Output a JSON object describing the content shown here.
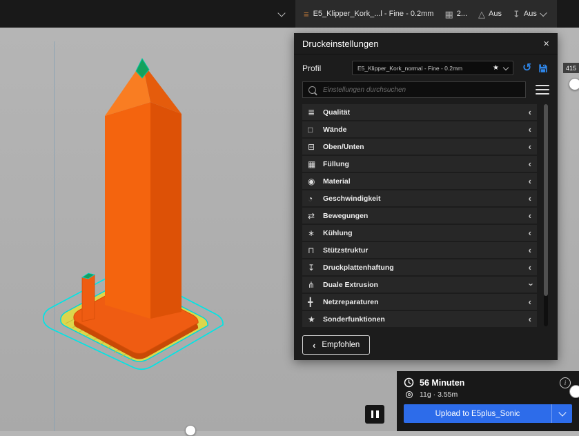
{
  "topbar": {
    "profile_summary": "E5_Klipper_Kork_...l - Fine - 0.2mm",
    "infill_value": "2...",
    "support_value": "Aus",
    "adhesion_value": "Aus"
  },
  "panel": {
    "title": "Druckeinstellungen",
    "profile_label": "Profil",
    "profile_value": "E5_Klipper_Kork_normal - Fine - 0.2mm",
    "search_placeholder": "Einstellungen durchsuchen",
    "recommended_label": "Empfohlen",
    "categories": [
      {
        "icon": "quality",
        "glyph": "≣",
        "label": "Qualität"
      },
      {
        "icon": "walls",
        "glyph": "□",
        "label": "Wände"
      },
      {
        "icon": "top-bottom",
        "glyph": "⊟",
        "label": "Oben/Unten"
      },
      {
        "icon": "infill",
        "glyph": "▦",
        "label": "Füllung"
      },
      {
        "icon": "material",
        "glyph": "◉",
        "label": "Material"
      },
      {
        "icon": "speed",
        "glyph": "◔",
        "label": "Geschwindigkeit"
      },
      {
        "icon": "travel",
        "glyph": "⇄",
        "label": "Bewegungen"
      },
      {
        "icon": "cooling",
        "glyph": "∗",
        "label": "Kühlung"
      },
      {
        "icon": "support",
        "glyph": "⊓",
        "label": "Stützstruktur"
      },
      {
        "icon": "adhesion",
        "glyph": "↧",
        "label": "Druckplattenhaftung"
      },
      {
        "icon": "dual-extrusion",
        "glyph": "⋔",
        "label": "Duale Extrusion",
        "expanded": true
      },
      {
        "icon": "mesh-fixes",
        "glyph": "╋",
        "label": "Netzreparaturen"
      },
      {
        "icon": "special-modes",
        "glyph": "★",
        "label": "Sonderfunktionen"
      }
    ]
  },
  "icons": {
    "close": "×",
    "star": "★",
    "reset": "↺",
    "profile": "≡",
    "infill": "▦",
    "support": "△",
    "adhesion": "↧",
    "collapsed_chevron": "‹",
    "info": "i"
  },
  "layer_slider": {
    "top_layer": "415"
  },
  "job_panel": {
    "time_estimate": "56 Minuten",
    "material_estimate": "11g · 3.55m",
    "upload_label": "Upload to E5plus_Sonic"
  },
  "colors": {
    "accent_blue": "#2d6cea",
    "model_orange": "#f4640e",
    "raft_yellow": "#ddd64c",
    "line_cyan": "#00e5e5"
  }
}
